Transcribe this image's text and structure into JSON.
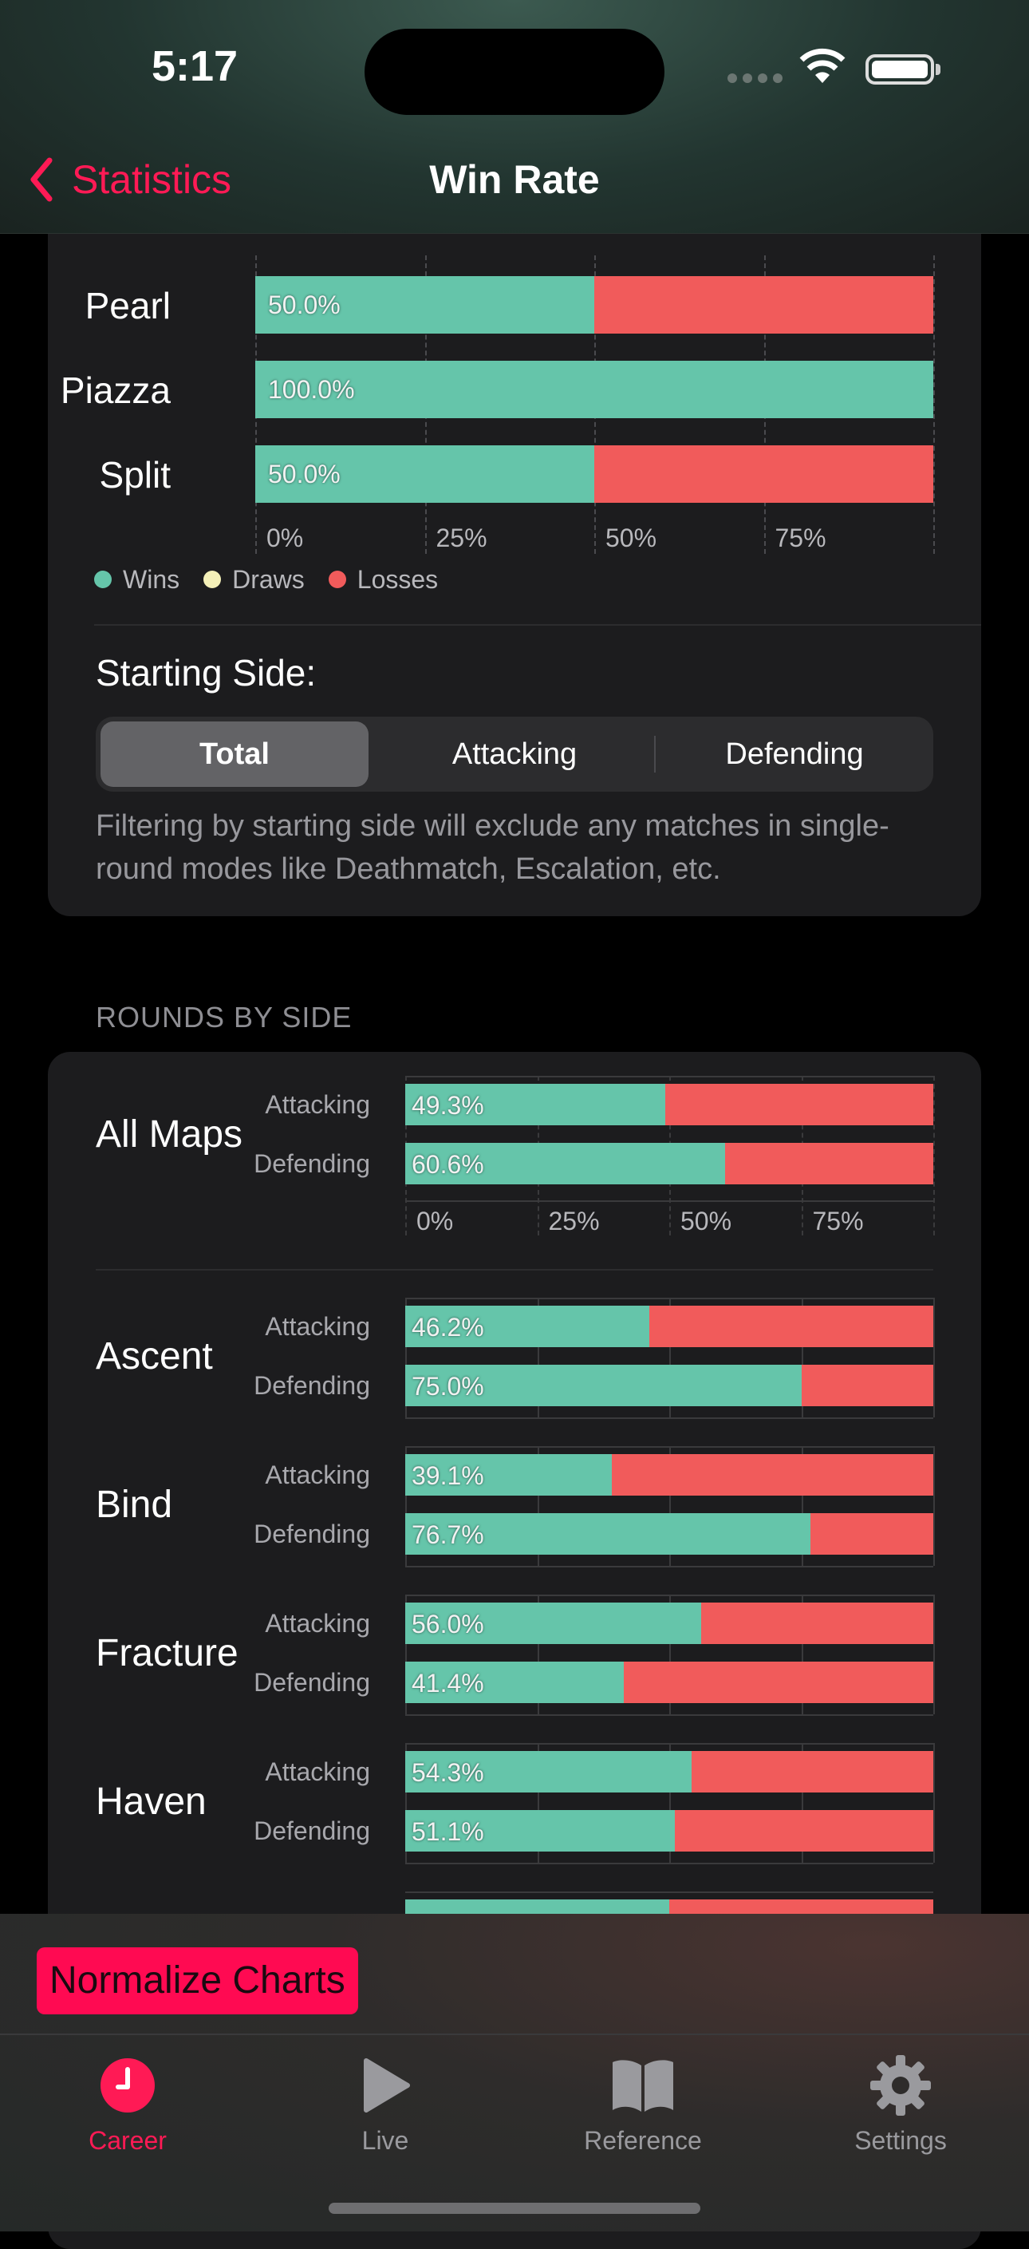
{
  "status_bar": {
    "time": "5:17"
  },
  "nav": {
    "back_label": "Statistics",
    "title": "Win Rate"
  },
  "win_rate_chart": {
    "rows": [
      {
        "map": "Pearl",
        "wins_pct": 50.0,
        "label": "50.0%"
      },
      {
        "map": "Piazza",
        "wins_pct": 100.0,
        "label": "100.0%"
      },
      {
        "map": "Split",
        "wins_pct": 50.0,
        "label": "50.0%"
      }
    ],
    "axis_ticks": [
      "0%",
      "25%",
      "50%",
      "75%"
    ],
    "legend": [
      {
        "label": "Wins",
        "color": "#65c5aa"
      },
      {
        "label": "Draws",
        "color": "#f4f0b8"
      },
      {
        "label": "Losses",
        "color": "#f15b5b"
      }
    ]
  },
  "starting_side": {
    "label": "Starting Side:",
    "options": [
      "Total",
      "Attacking",
      "Defending"
    ],
    "selected": "Total",
    "note": "Filtering by starting side will exclude any matches in single-round modes like Deathmatch, Escalation, etc."
  },
  "rounds_by_side": {
    "section_title": "ROUNDS BY SIDE",
    "axis_ticks": [
      "0%",
      "25%",
      "50%",
      "75%"
    ],
    "side_labels": {
      "attacking": "Attacking",
      "defending": "Defending"
    },
    "groups": [
      {
        "map": "All Maps",
        "attacking": 49.3,
        "attacking_label": "49.3%",
        "defending": 60.6,
        "defending_label": "60.6%"
      },
      {
        "map": "Ascent",
        "attacking": 46.2,
        "attacking_label": "46.2%",
        "defending": 75.0,
        "defending_label": "75.0%"
      },
      {
        "map": "Bind",
        "attacking": 39.1,
        "attacking_label": "39.1%",
        "defending": 76.7,
        "defending_label": "76.7%"
      },
      {
        "map": "Fracture",
        "attacking": 56.0,
        "attacking_label": "56.0%",
        "defending": 41.4,
        "defending_label": "41.4%"
      },
      {
        "map": "Haven",
        "attacking": 54.3,
        "attacking_label": "54.3%",
        "defending": 51.1,
        "defending_label": "51.1%"
      }
    ]
  },
  "normalize_button": "Normalize Charts",
  "tab_bar": {
    "tabs": [
      {
        "label": "Career",
        "icon": "clock-icon",
        "active": true
      },
      {
        "label": "Live",
        "icon": "play-icon",
        "active": false
      },
      {
        "label": "Reference",
        "icon": "book-icon",
        "active": false
      },
      {
        "label": "Settings",
        "icon": "gear-icon",
        "active": false
      }
    ]
  },
  "colors": {
    "accent": "#ff1a55",
    "wins": "#65c5aa",
    "losses": "#f15b5b"
  }
}
